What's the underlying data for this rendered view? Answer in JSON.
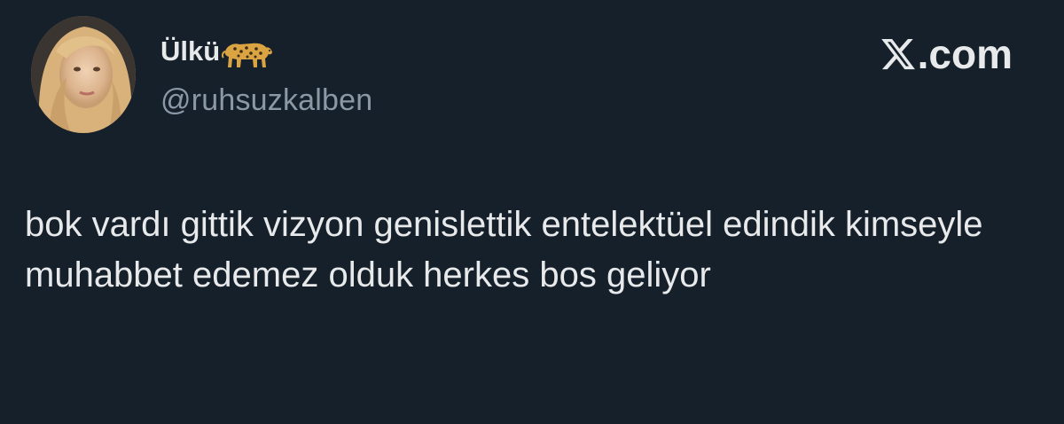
{
  "tweet": {
    "author": {
      "display_name": "Ülkü",
      "name_emoji": "leopard-icon",
      "handle": "@ruhsuzkalben",
      "avatar": "avatar"
    },
    "brand": {
      "logo_icon": "x-logo-icon",
      "suffix": ".com"
    },
    "text": "bok vardı gittik vizyon genislettik entelektüel edindik kimseyle muhabbet edemez olduk herkes bos geliyor"
  },
  "colors": {
    "background": "#15202b",
    "primary_text": "#e7e9ea",
    "secondary_text": "#8b98a5"
  }
}
